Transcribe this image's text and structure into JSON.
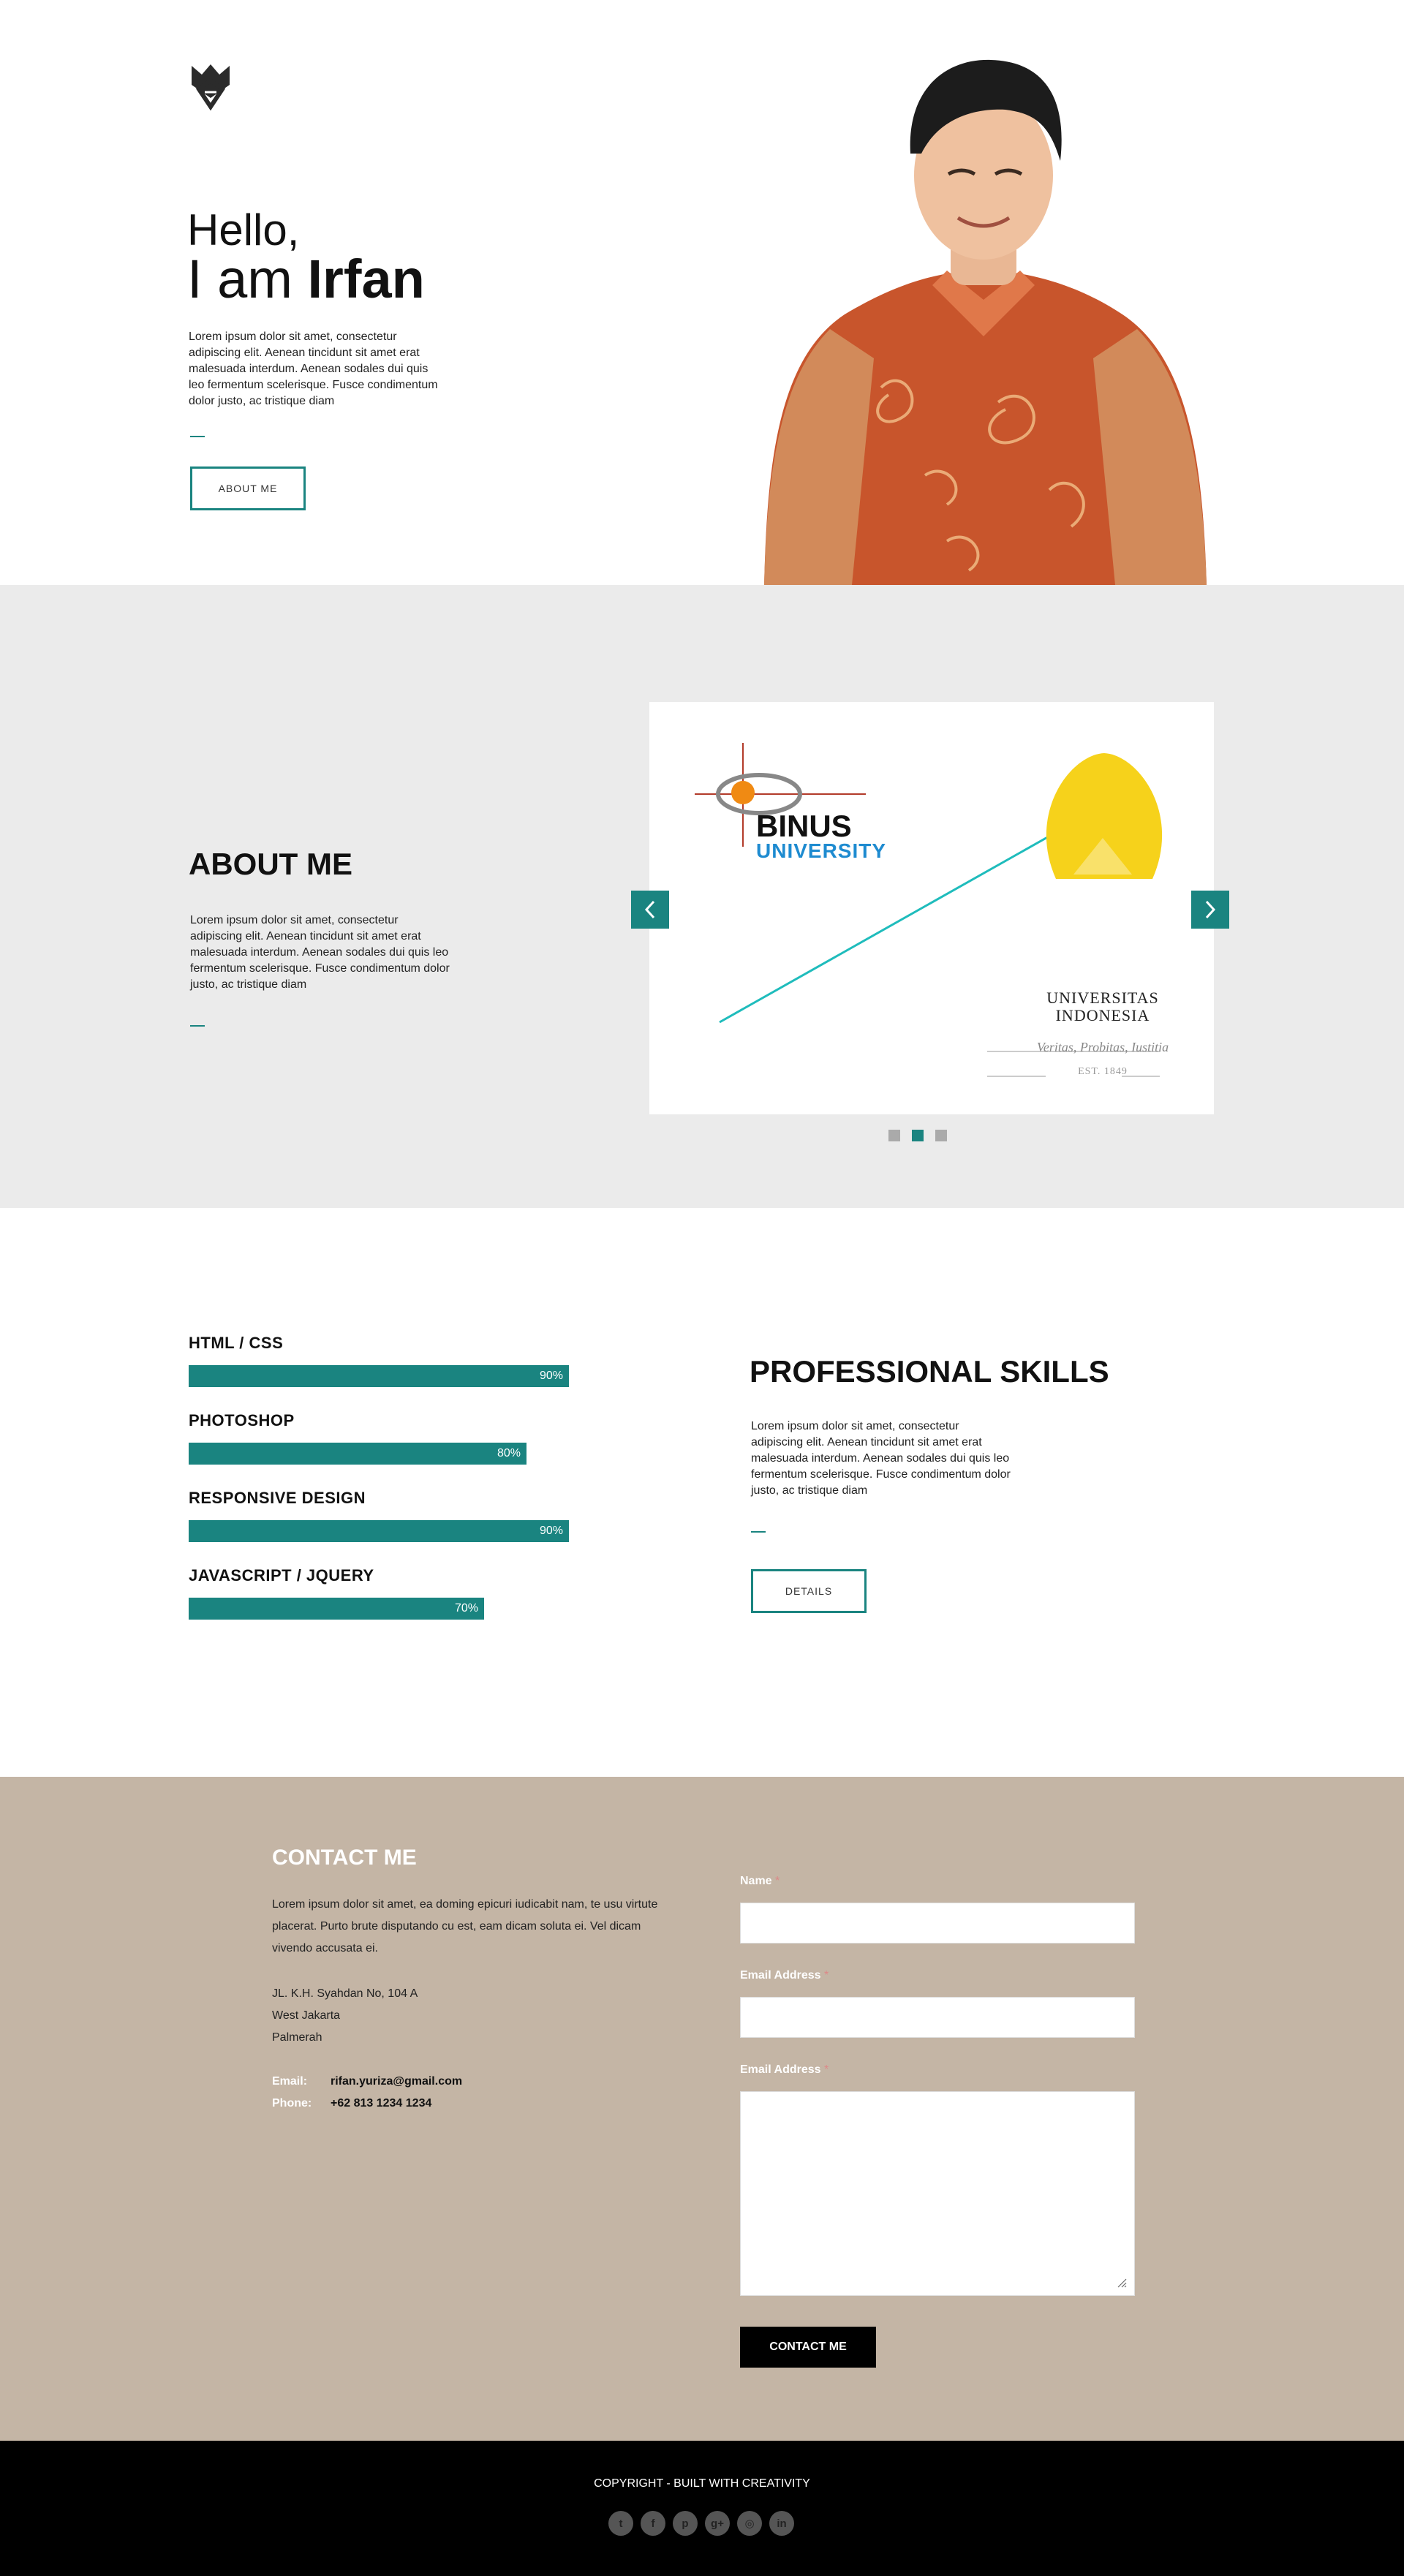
{
  "hero": {
    "greeting": "Hello,",
    "intro_prefix": "I am ",
    "name": "Irfan",
    "description": "Lorem ipsum dolor sit amet, consectetur adipiscing elit. Aenean tincidunt sit amet erat malesuada interdum. Aenean sodales dui quis leo fermentum scelerisque. Fusce condimentum dolor justo, ac tristique diam",
    "button_label": "ABOUT ME"
  },
  "about": {
    "title": "ABOUT ME",
    "description": "Lorem ipsum dolor sit amet, consectetur adipiscing elit. Aenean tincidunt sit amet erat malesuada interdum. Aenean sodales dui quis leo fermentum scelerisque. Fusce condimentum dolor justo, ac tristique diam",
    "slide": {
      "left_logo_name": "BINUS",
      "left_logo_sub": "UNIVERSITY",
      "right_logo_line1": "UNIVERSITAS",
      "right_logo_line2": "INDONESIA",
      "right_logo_motto": "Veritas, Probitas, Iustitia",
      "right_logo_est": "EST. 1849"
    },
    "slider_dots_count": 3,
    "active_dot_index": 1
  },
  "skills": {
    "title": "PROFESSIONAL SKILLS",
    "description": "Lorem ipsum dolor sit amet, consectetur adipiscing elit. Aenean tincidunt sit amet erat malesuada interdum. Aenean sodales dui quis leo fermentum scelerisque. Fusce condimentum dolor justo, ac tristique diam",
    "button_label": "DETAILS",
    "items": [
      {
        "label": "HTML  /  CSS",
        "percent_label": "90%",
        "percent": 90
      },
      {
        "label": "PHOTOSHOP",
        "percent_label": "80%",
        "percent": 80
      },
      {
        "label": "RESPONSIVE DESIGN",
        "percent_label": "90%",
        "percent": 90
      },
      {
        "label": "JAVASCRIPT  /  JQUERY",
        "percent_label": "70%",
        "percent": 70
      }
    ]
  },
  "contact": {
    "title": "CONTACT ME",
    "description": "Lorem ipsum dolor sit amet, ea doming epicuri iudicabit nam, te usu virtute placerat. Purto brute disputando cu est, eam dicam soluta ei. Vel dicam vivendo accusata ei.",
    "address_line1": "JL. K.H. Syahdan No, 104 A",
    "address_line2": "West Jakarta",
    "address_line3": "Palmerah",
    "email_label": "Email:",
    "email_value": "rifan.yuriza@gmail.com",
    "phone_label": "Phone:",
    "phone_value": "+62 813 1234 1234",
    "form": {
      "name_label": "Name",
      "email_label": "Email Address",
      "message_label": "Email Address",
      "required_mark": "*",
      "submit_label": "CONTACT ME"
    }
  },
  "footer": {
    "copyright": "COPYRIGHT - BUILT WITH CREATIVITY",
    "socials": [
      {
        "name": "twitter-icon",
        "glyph": "t"
      },
      {
        "name": "facebook-icon",
        "glyph": "f"
      },
      {
        "name": "pinterest-icon",
        "glyph": "p"
      },
      {
        "name": "google-plus-icon",
        "glyph": "g+"
      },
      {
        "name": "dribbble-icon",
        "glyph": "◎"
      },
      {
        "name": "linkedin-icon",
        "glyph": "in"
      }
    ]
  },
  "colors": {
    "accent": "#1a8480",
    "about_bg": "#ebebeb",
    "contact_bg": "#c4b5a5",
    "footer_bg": "#000000"
  }
}
